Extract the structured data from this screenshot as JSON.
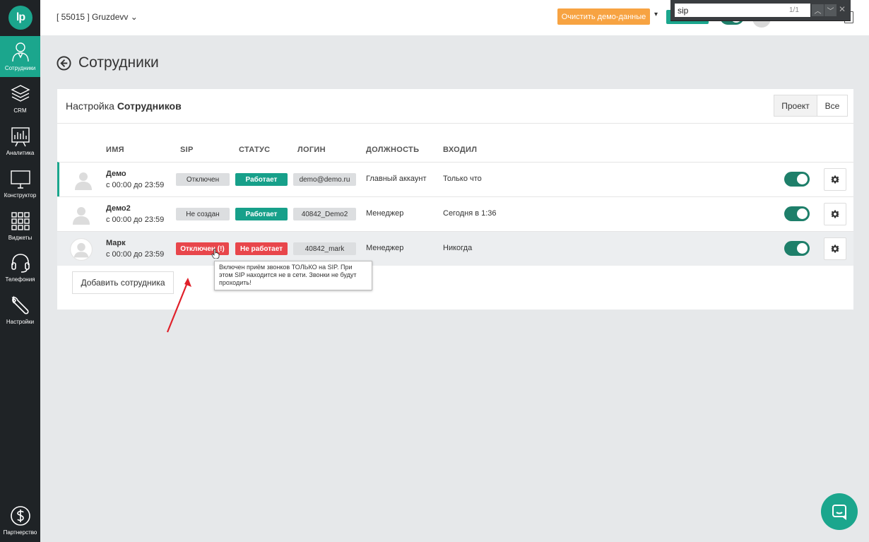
{
  "sidebar": {
    "logo": "lp",
    "items": [
      {
        "label": "Сотрудники",
        "icon": "employee-icon",
        "active": true
      },
      {
        "label": "CRM",
        "icon": "layers-icon"
      },
      {
        "label": "Аналитика",
        "icon": "analytics-icon"
      },
      {
        "label": "Конструктор",
        "icon": "monitor-icon"
      },
      {
        "label": "Виджеты",
        "icon": "grid-icon"
      },
      {
        "label": "Телефония",
        "icon": "headset-icon"
      },
      {
        "label": "Настройки",
        "icon": "wrench-icon"
      },
      {
        "label": "Партнерство",
        "icon": "dollar-icon"
      }
    ]
  },
  "topbar": {
    "account": "[ 55015 ] Gruzdevv",
    "demo_button": "Очистить демо-данные"
  },
  "findbar": {
    "query": "sip",
    "count": "1/1"
  },
  "page": {
    "title": "Сотрудники"
  },
  "card": {
    "title_prefix": "Настройка ",
    "title_bold": "Сотрудников",
    "filters": [
      "Проект",
      "Все"
    ],
    "columns": [
      "ИМЯ",
      "SIP",
      "СТАТУС",
      "ЛОГИН",
      "ДОЛЖНОСТЬ",
      "ВХОДИЛ"
    ],
    "rows": [
      {
        "name": "Демо",
        "hours": "с 00:00 до 23:59",
        "sip": "Отключен",
        "status": "Работает",
        "login": "demo@demo.ru",
        "position": "Главный аккаунт",
        "last_login": "Только что"
      },
      {
        "name": "Демо2",
        "hours": "с 00:00 до 23:59",
        "sip": "Не создан",
        "status": "Работает",
        "login": "40842_Demo2",
        "position": "Менеджер",
        "last_login": "Сегодня в 1:36"
      },
      {
        "name": "Марк",
        "hours": "с 00:00 до 23:59",
        "sip": "Отключен (!)",
        "status": "Не работает",
        "login": "40842_mark",
        "position": "Менеджер",
        "last_login": "Никогда"
      }
    ],
    "add_button": "Добавить сотрудника"
  },
  "tooltip": {
    "text": "Включен приём звонков ТОЛЬКО на SIP. При этом SIP находится не в сети. Звонки не будут проходить!"
  },
  "colors": {
    "brand": "#1ba68d",
    "sidebar_bg": "#1f2326",
    "demo_orange": "#f7a342",
    "danger": "#e8464b",
    "annotation_arrow": "#e0202a"
  }
}
